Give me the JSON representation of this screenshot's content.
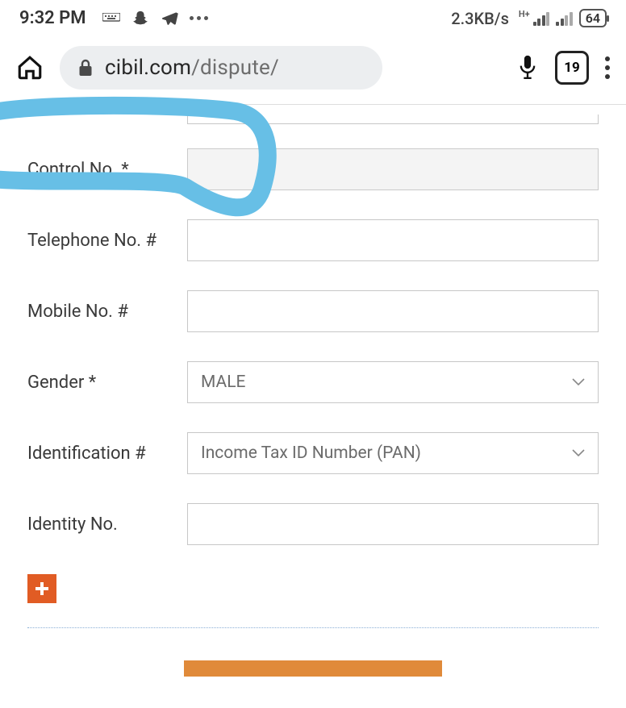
{
  "status_bar": {
    "time": "9:32 PM",
    "data_rate": "2.3KB/s",
    "network_indicator": "H+",
    "battery": "64"
  },
  "browser": {
    "url_domain": "cibil.com",
    "url_path": "/dispute/",
    "tab_count": "19"
  },
  "form": {
    "control_no": {
      "label": "Control No. *",
      "value": ""
    },
    "telephone": {
      "label": "Telephone No. #",
      "value": ""
    },
    "mobile": {
      "label": "Mobile No. #",
      "value": ""
    },
    "gender": {
      "label": "Gender *",
      "value": "MALE"
    },
    "identification": {
      "label": "Identification #",
      "value": "Income Tax ID Number (PAN)"
    },
    "identity_no": {
      "label": "Identity No.",
      "value": ""
    }
  }
}
